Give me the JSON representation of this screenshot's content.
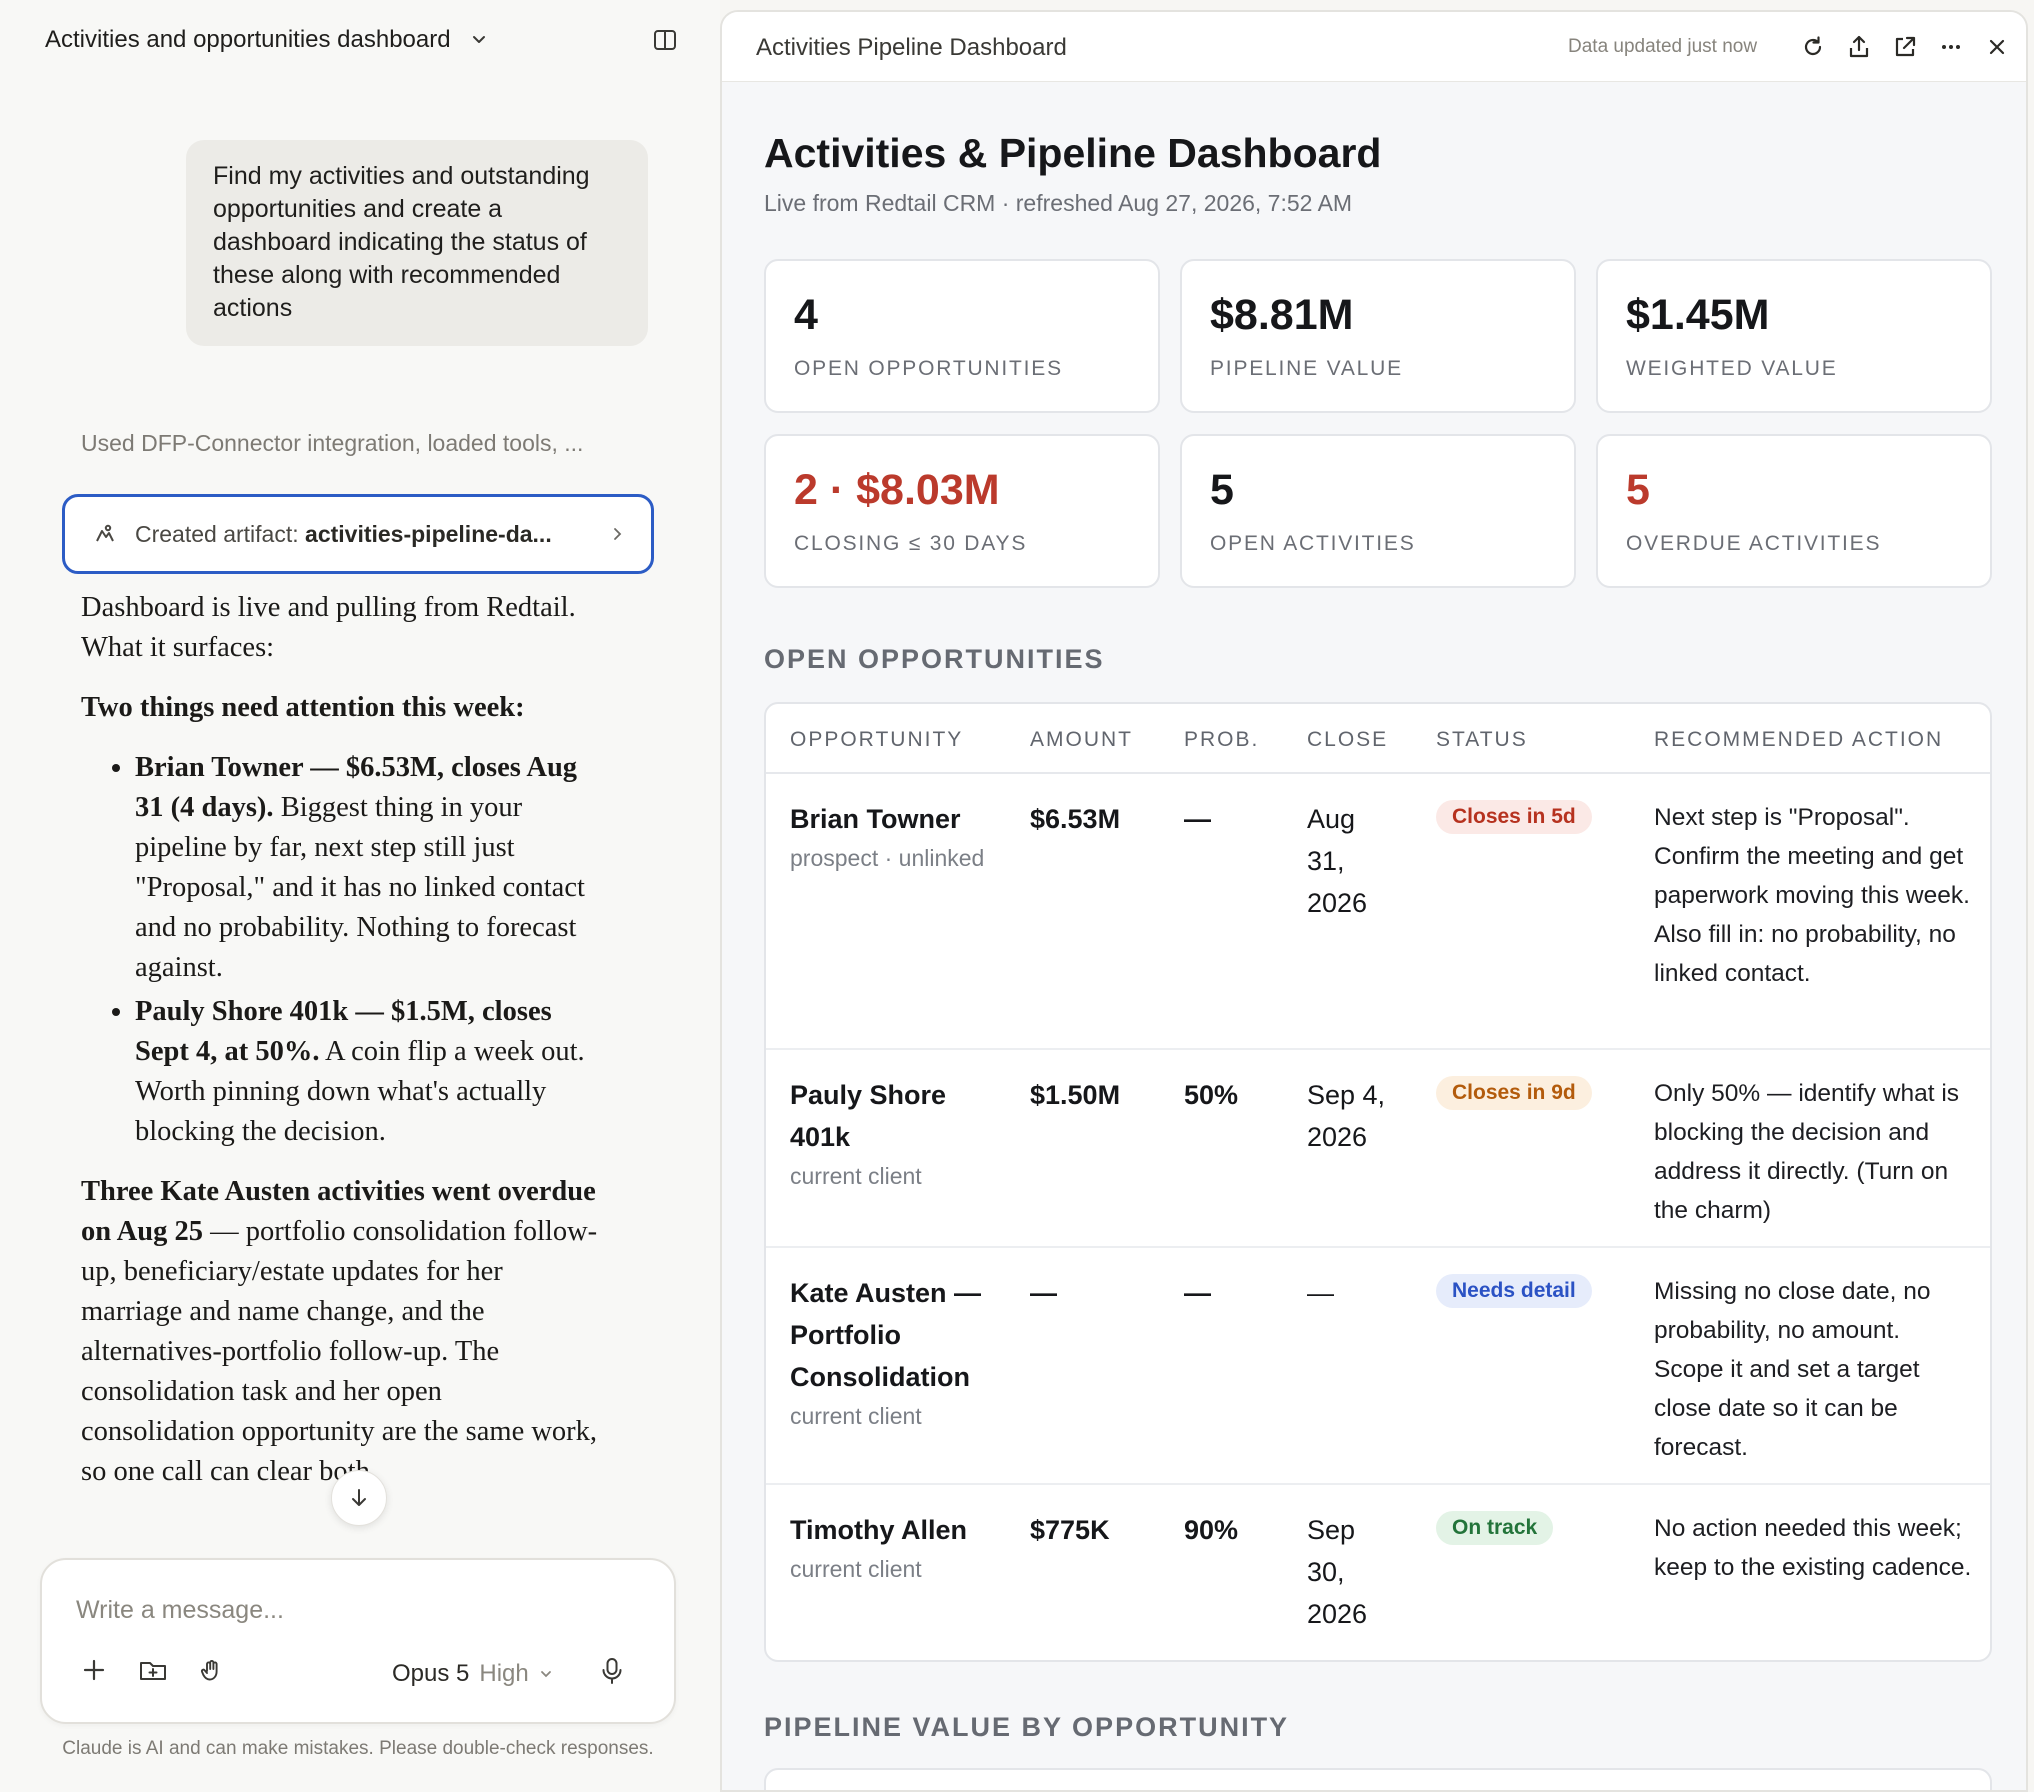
{
  "chat": {
    "title": "Activities and opportunities dashboard",
    "user_message": "Find my activities and outstanding opportunities and create a dashboard indicating the status of these along with recommended actions",
    "tool_summary": "Used DFP-Connector integration, loaded tools, ...",
    "artifact_prefix": "Created artifact: ",
    "artifact_name": "activities-pipeline-da...",
    "assistant": {
      "intro": "Dashboard is live and pulling from Redtail. What it surfaces:",
      "heading": "Two things need attention this week:",
      "bullets": [
        {
          "bold": "Brian Towner — $6.53M, closes Aug 31 (4 days).",
          "text": " Biggest thing in your pipeline by far, next step still just \"Proposal,\" and it has no linked contact and no probability. Nothing to forecast against."
        },
        {
          "bold": "Pauly Shore 401k — $1.5M, closes Sept 4, at 50%.",
          "text": " A coin flip a week out. Worth pinning down what's actually blocking the decision."
        }
      ],
      "para_bold": "Three Kate Austen activities went overdue on Aug 25",
      "para_text": " — portfolio consolidation follow-up, beneficiary/estate updates for her marriage and name change, and the alternatives-portfolio follow-up. The consolidation task and her open consolidation opportunity are the same work, so one call can clear both."
    },
    "composer": {
      "placeholder": "Write a message...",
      "model": "Opus 5",
      "effort": "High"
    },
    "disclaimer": "Claude is AI and can make mistakes. Please double-check responses."
  },
  "artifact": {
    "window_title": "Activities Pipeline Dashboard",
    "updated_note": "Data updated just now",
    "icons": [
      "refresh-icon",
      "share-icon",
      "open-external-icon",
      "more-icon",
      "close-icon"
    ]
  },
  "dashboard": {
    "title": "Activities & Pipeline Dashboard",
    "subtitle": "Live from Redtail CRM · refreshed Aug 27, 2026, 7:52 AM",
    "kpis": [
      {
        "value": "4",
        "label": "OPEN OPPORTUNITIES",
        "accent": false
      },
      {
        "value": "$8.81M",
        "label": "PIPELINE VALUE",
        "accent": false
      },
      {
        "value": "$1.45M",
        "label": "WEIGHTED VALUE",
        "accent": false
      },
      {
        "value": "2 · $8.03M",
        "label": "CLOSING ≤ 30 DAYS",
        "accent": true
      },
      {
        "value": "5",
        "label": "OPEN ACTIVITIES",
        "accent": false
      },
      {
        "value": "5",
        "label": "OVERDUE ACTIVITIES",
        "accent": true
      }
    ],
    "opportunities_section": "OPEN OPPORTUNITIES",
    "columns": [
      "OPPORTUNITY",
      "AMOUNT",
      "PROB.",
      "CLOSE",
      "STATUS",
      "RECOMMENDED ACTION"
    ],
    "rows": [
      {
        "name": "Brian Towner",
        "sub": "prospect · unlinked",
        "amount": "$6.53M",
        "prob": "—",
        "close": "Aug 31, 2026",
        "status": "Closes in 5d",
        "status_kind": "red",
        "action": "Next step is \"Proposal\". Confirm the meeting and get paperwork moving this week. Also fill in: no probability, no linked contact."
      },
      {
        "name": "Pauly Shore 401k",
        "sub": "current client",
        "amount": "$1.50M",
        "prob": "50%",
        "close": "Sep 4, 2026",
        "status": "Closes in 9d",
        "status_kind": "orange",
        "action": "Only 50% — identify what is blocking the decision and address it directly. (Turn on the charm)"
      },
      {
        "name": "Kate Austen — Portfolio Consolidation",
        "sub": "current client",
        "amount": "—",
        "prob": "—",
        "close": "—",
        "status": "Needs detail",
        "status_kind": "blue",
        "action": "Missing no close date, no probability, no amount. Scope it and set a target close date so it can be forecast."
      },
      {
        "name": "Timothy Allen",
        "sub": "current client",
        "amount": "$775K",
        "prob": "90%",
        "close": "Sep 30, 2026",
        "status": "On track",
        "status_kind": "green",
        "action": "No action needed this week; keep to the existing cadence."
      }
    ],
    "chart_section": "PIPELINE VALUE BY OPPORTUNITY"
  },
  "colors": {
    "accent_blue": "#2c5cc5",
    "alert_red": "#bb3a2c"
  }
}
